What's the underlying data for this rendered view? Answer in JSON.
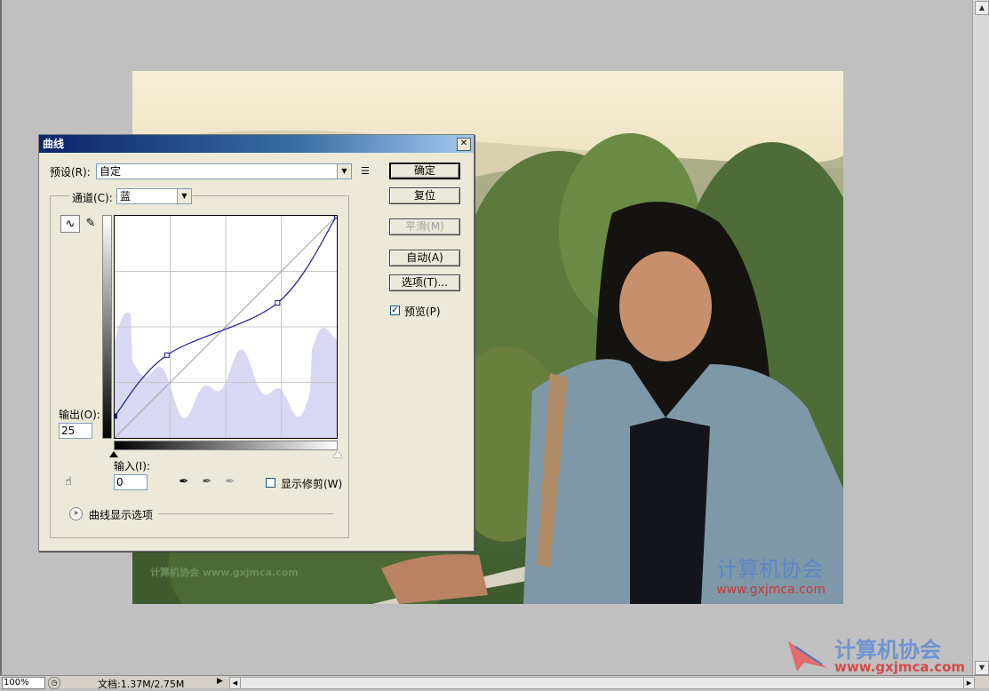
{
  "dialog": {
    "title": "曲线",
    "close_symbol": "✕",
    "preset_label": "预设(R):",
    "preset_value": "自定",
    "preset_menu_icon": "menu-list-icon",
    "channel_label": "通道(C):",
    "channel_value": "蓝",
    "output_label": "输出(O):",
    "output_value": "25",
    "input_label": "输入(I):",
    "input_value": "0",
    "show_clipping_label": "显示修剪(W)",
    "show_clipping_checked": false,
    "curve_display_options_label": "曲线显示选项",
    "preview_label": "预览(P)",
    "preview_checked": true,
    "buttons": {
      "ok": "确定",
      "reset": "复位",
      "smooth": "平滑(M)",
      "auto": "自动(A)",
      "options": "选项(T)..."
    },
    "curve_points": [
      [
        0,
        25
      ],
      [
        60,
        95
      ],
      [
        187,
        155
      ],
      [
        255,
        255
      ]
    ]
  },
  "watermarks": {
    "photo_left": "计算机协会 www.gxjmca.com",
    "photo_right_cn": "计算机协会",
    "photo_right_url": "www.gxjmca.com",
    "canvas_cn": "计算机协会",
    "canvas_url": "www.gxjmca.com"
  },
  "status": {
    "zoom": "100%",
    "doc_info": "文档:1.37M/2.75M"
  },
  "colors": {
    "titlebar_start": "#0a246a",
    "titlebar_end": "#a6caf0",
    "histogram": "#d8d8f4",
    "curve": "#1a1a8c",
    "watermark": "#3b6fb5"
  }
}
